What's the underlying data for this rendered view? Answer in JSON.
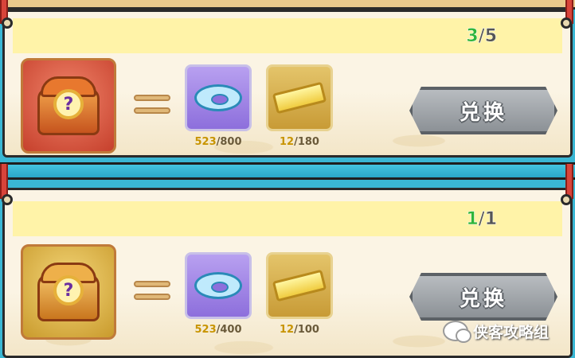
{
  "rows": [
    {
      "progress_current": "3",
      "progress_total": "/5",
      "main_item_icon": "red-mystery-chest-icon",
      "chest_mark": "?",
      "materials": [
        {
          "icon": "swim-ring-icon",
          "have": "523",
          "need": "/800"
        },
        {
          "icon": "golden-scroll-icon",
          "have": "12",
          "need": "/180"
        }
      ],
      "button_label": "兑换"
    },
    {
      "progress_current": "1",
      "progress_total": "/1",
      "main_item_icon": "gold-mystery-chest-icon",
      "chest_mark": "?",
      "materials": [
        {
          "icon": "swim-ring-icon",
          "have": "523",
          "need": "/400"
        },
        {
          "icon": "golden-scroll-icon",
          "have": "12",
          "need": "/100"
        }
      ],
      "button_label": "兑换"
    }
  ],
  "watermark": {
    "text": "侠客攻略组",
    "icon": "wechat-icon"
  },
  "colors": {
    "progress_current": "#2fb53a",
    "material_have": "#c89400",
    "button": "#9ca0a5",
    "strip": "#3ab7d4"
  }
}
